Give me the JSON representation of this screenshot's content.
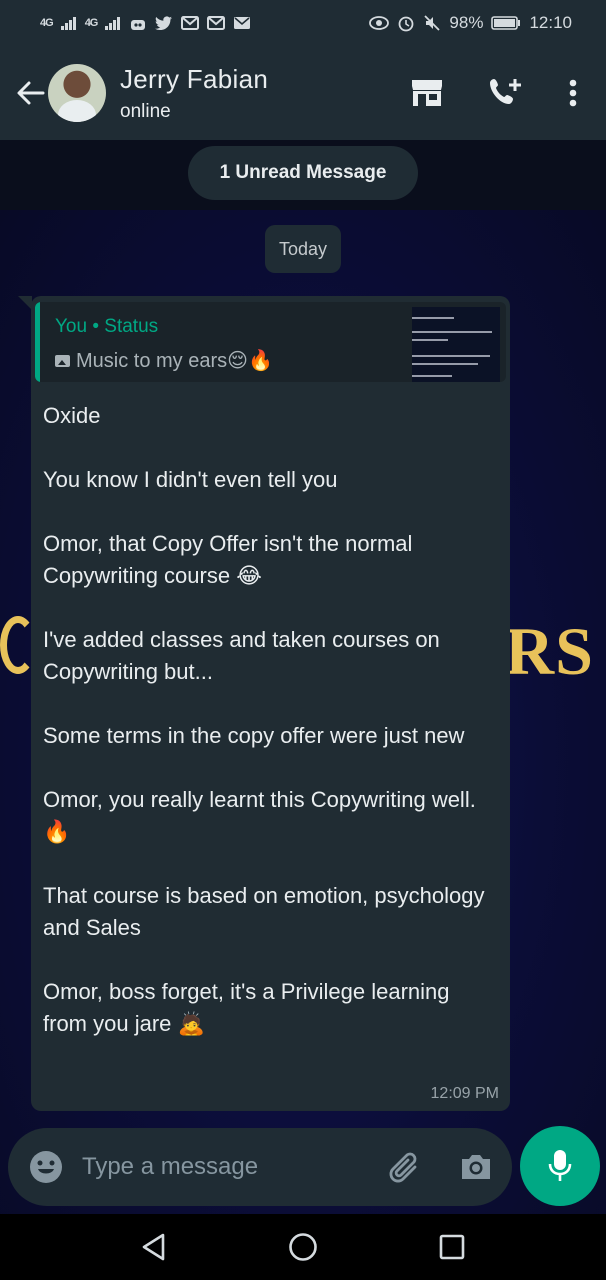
{
  "status_bar": {
    "network1": "4G",
    "network2": "4G",
    "battery": "98%",
    "time": "12:10"
  },
  "header": {
    "contact_name": "Jerry Fabian",
    "presence": "online"
  },
  "unread_banner": "1 Unread Message",
  "date_divider": "Today",
  "message": {
    "quote": {
      "author": "You • Status",
      "text": "Music to my ears😌🔥"
    },
    "paragraphs": [
      "Oxide",
      "You know I didn't even tell you",
      "Omor, that Copy Offer isn't the normal Copywriting course 😂",
      "I've added classes and taken courses on Copywriting but...",
      "Some terms in the copy offer were just new",
      "Omor, you really learnt this Copywriting well. 🔥",
      "That course is based on emotion, psychology and Sales",
      "Omor, boss forget, it's a Privilege learning from you jare 🙇"
    ],
    "time": "12:09 PM"
  },
  "wallpaper": {
    "visible_text": "RS"
  },
  "composer": {
    "placeholder": "Type a message"
  },
  "colors": {
    "accent": "#00a884",
    "bubble": "#202c33",
    "bar": "#1f2c34"
  }
}
